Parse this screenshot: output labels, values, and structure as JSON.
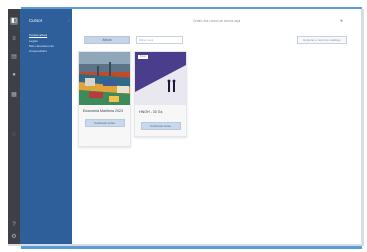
{
  "rail": {
    "icons": [
      "app-icon",
      "menu-icon",
      "courses-icon",
      "people-icon",
      "calendar-icon",
      "chat-icon",
      "help-icon",
      "settings-icon"
    ]
  },
  "sidebar": {
    "title": "Cursor",
    "items": [
      {
        "label": "Cursos ativos",
        "active": true
      },
      {
        "label": "Legais",
        "active": false
      },
      {
        "label": "Não cancelamento",
        "active": false
      },
      {
        "label": "Arrependidos",
        "active": false
      }
    ]
  },
  "header": {
    "title": "Centro dos cursos de cursos aqui"
  },
  "toolbar": {
    "active_label": "Ativos",
    "filter_placeholder": "Filtrar aqui",
    "catalog_label": "Explorar o resto do catálogo"
  },
  "courses": [
    {
      "title": "Economia Marítima 2023",
      "button": "Continuar curso",
      "tag": ""
    },
    {
      "title": "HNOH - 30 Gs",
      "button": "Continuar curso",
      "tag": "Novo"
    }
  ],
  "colors": {
    "frame": "#5b9bd8",
    "rail": "#3e4046",
    "sidebar": "#2e5f9b",
    "button": "#c9d8ea"
  }
}
